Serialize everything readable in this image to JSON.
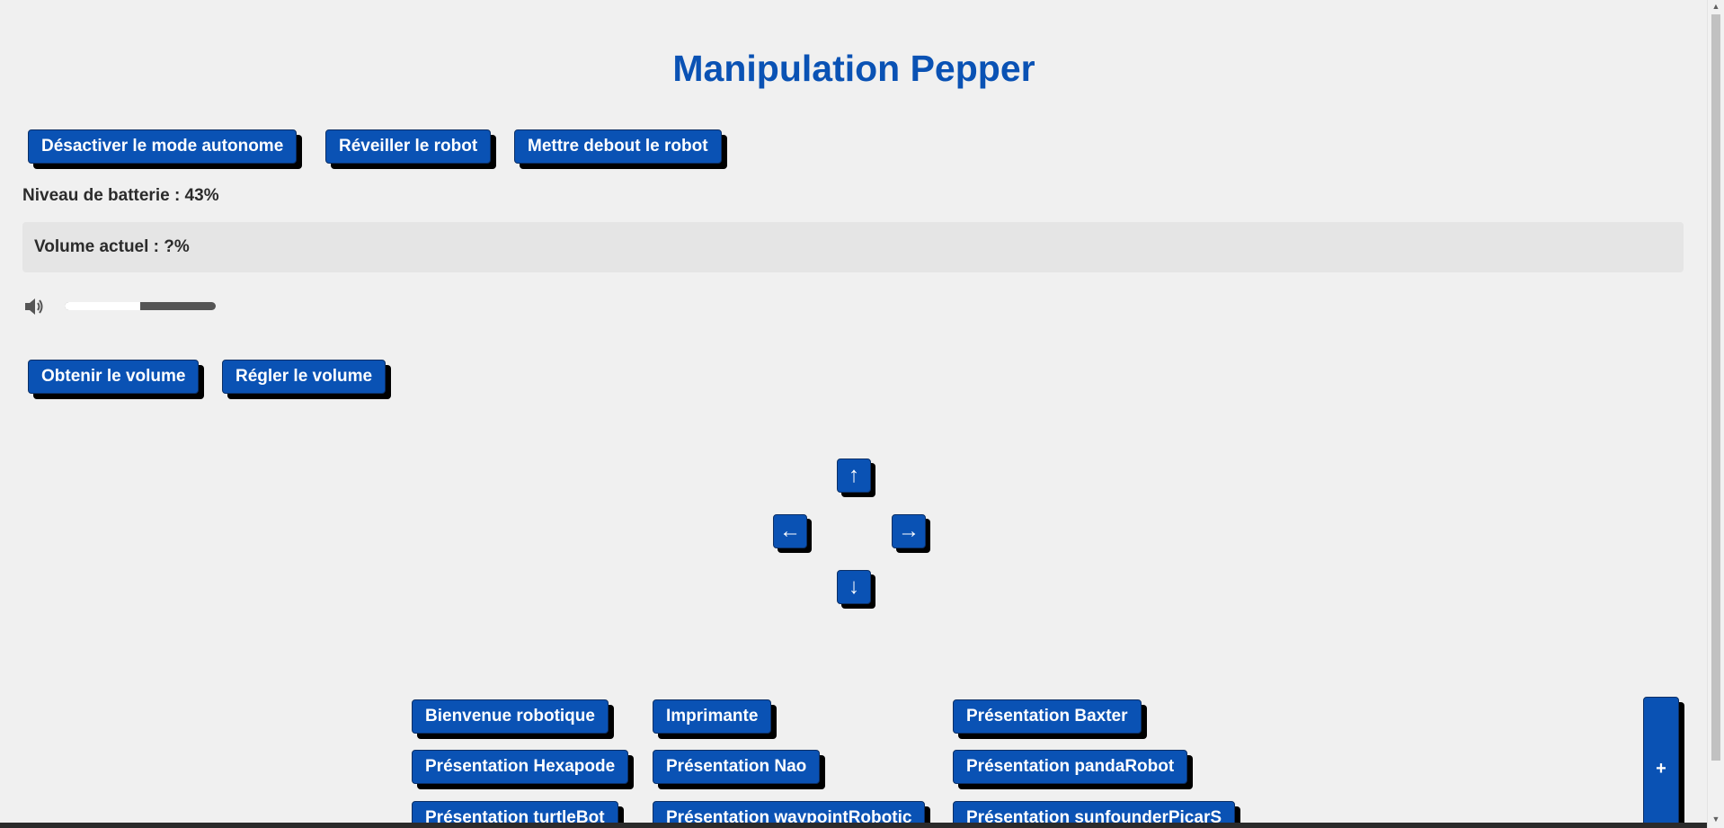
{
  "page": {
    "title": "Manipulation Pepper"
  },
  "controls": {
    "disable_autonomous": "Désactiver le mode autonome",
    "wake_robot": "Réveiller le robot",
    "stand_robot": "Mettre debout le robot"
  },
  "battery": {
    "text": "Niveau de batterie : 43%"
  },
  "volume": {
    "current_text": "Volume actuel : ?%",
    "slider_fraction": 0.5,
    "get_label": "Obtenir le volume",
    "set_label": "Régler le volume",
    "speaker_icon": "speaker-icon"
  },
  "arrows": {
    "up": "↑",
    "left": "←",
    "right": "→",
    "down": "↓"
  },
  "presentations": {
    "bienvenue": "Bienvenue robotique",
    "imprimante": "Imprimante",
    "baxter": "Présentation Baxter",
    "hexapode": "Présentation Hexapode",
    "nao": "Présentation Nao",
    "panda": "Présentation pandaRobot",
    "turtlebot": "Présentation turtleBot",
    "waypoint": "Présentation waypointRobotic",
    "sunfounder": "Présentation sunfounderPicarS"
  },
  "more_button": "+",
  "colors": {
    "accent": "#0a52b4",
    "background": "#f0f0f0",
    "shadow": "#000000"
  }
}
